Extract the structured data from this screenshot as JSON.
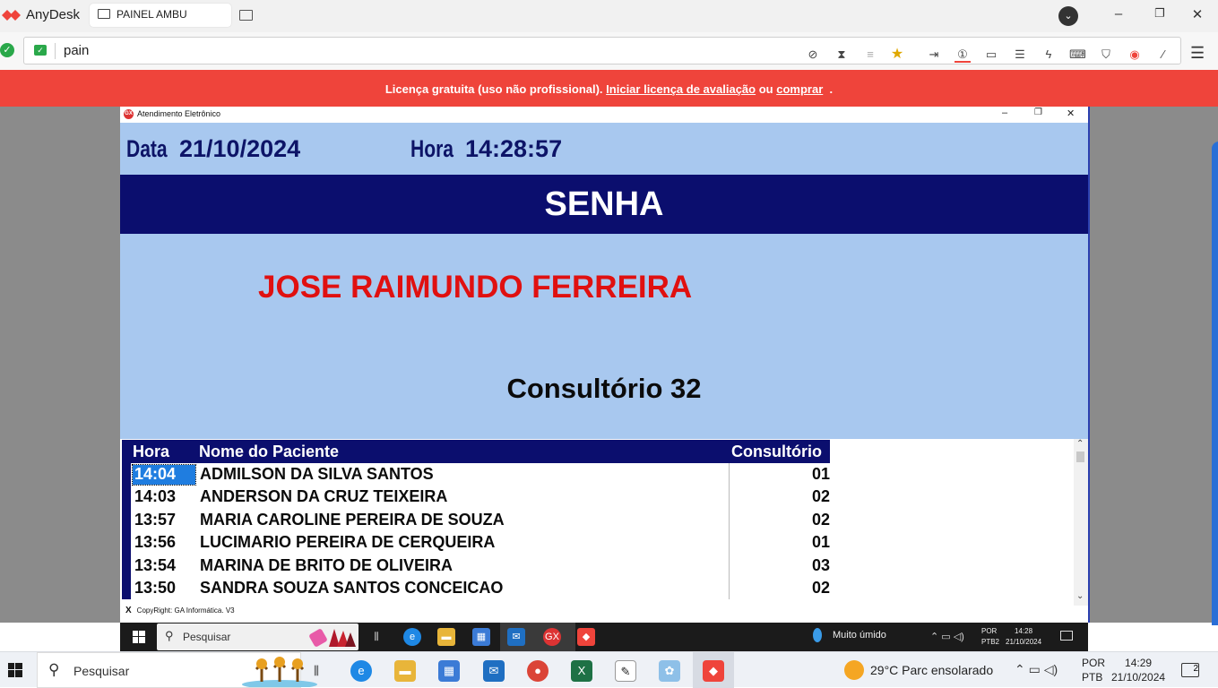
{
  "anydesk": {
    "brand": "AnyDesk",
    "tab_label": "PAINEL AMBU",
    "address_value": "pain",
    "banner": {
      "prefix": "Licença gratuita (uso não profissional).",
      "trial_link": "Iniciar licença de avaliação",
      "middle": "ou",
      "buy_link": "comprar",
      "suffix": "."
    },
    "toolbar_icons": [
      "privacy-icon",
      "hourglass-icon",
      "database-icon",
      "favorite-star-icon",
      "file-transfer-icon",
      "monitor-select-icon",
      "display-icon",
      "chat-icon",
      "actions-icon",
      "keyboard-icon",
      "permissions-icon",
      "record-icon",
      "whiteboard-icon",
      "menu-icon"
    ],
    "accent": "#ef443b"
  },
  "app": {
    "title": "Atendimento Eletrônico",
    "date_label": "Data",
    "date_value": "21/10/2024",
    "time_label": "Hora",
    "time_value": "14:28:57",
    "senha_label": "SENHA",
    "current_patient": "JOSE RAIMUNDO FERREIRA",
    "current_room": "Consultório 32",
    "list_headers": {
      "time": "Hora",
      "name": "Nome do Paciente",
      "room": "Consultório"
    },
    "rows": [
      {
        "time": "14:04",
        "name": "ADMILSON DA SILVA SANTOS",
        "room": "01"
      },
      {
        "time": "14:03",
        "name": "ANDERSON DA CRUZ TEIXEIRA",
        "room": "02"
      },
      {
        "time": "13:57",
        "name": "MARIA CAROLINE PEREIRA DE SOUZA",
        "room": "02"
      },
      {
        "time": "13:56",
        "name": "LUCIMARIO PEREIRA DE CERQUEIRA",
        "room": "01"
      },
      {
        "time": "13:54",
        "name": "MARINA DE BRITO DE OLIVEIRA",
        "room": "03"
      },
      {
        "time": "13:50",
        "name": "SANDRA SOUZA SANTOS CONCEICAO",
        "room": "02"
      }
    ],
    "footer_close": "X",
    "footer_text": "CopyRight: GA Informática. V3",
    "colors": {
      "navy": "#0b0e6e",
      "light_blue": "#a8c8ef",
      "patient_red": "#e01010"
    }
  },
  "remote_taskbar": {
    "search_placeholder": "Pesquisar",
    "weather": "Muito úmido",
    "lang_top": "POR",
    "lang_bottom": "PTB2",
    "clock_time": "14:28",
    "clock_date": "21/10/2024"
  },
  "local_taskbar": {
    "search_placeholder": "Pesquisar",
    "weather": "29°C  Parc ensolarado",
    "lang_top": "POR",
    "lang_bottom": "PTB",
    "clock_time": "14:29",
    "clock_date": "21/10/2024",
    "notification_count": "2"
  }
}
